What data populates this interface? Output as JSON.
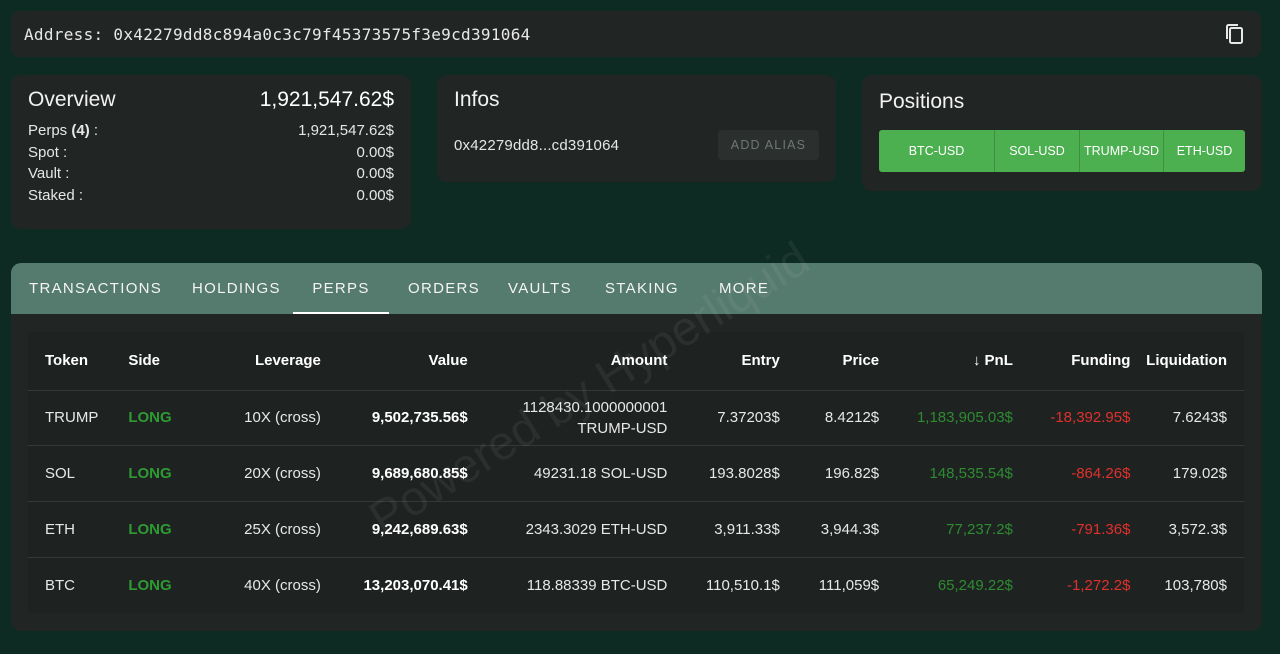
{
  "address_bar": {
    "label": "Address: 0x42279dd8c894a0c3c79f45373575f3e9cd391064",
    "copy_icon": "copy-icon"
  },
  "overview": {
    "title": "Overview",
    "total": "1,921,547.62$",
    "rows": [
      {
        "label": "Perps",
        "count": "(4)",
        "suffix": " :",
        "value": "1,921,547.62$"
      },
      {
        "label": "Spot :",
        "value": "0.00$"
      },
      {
        "label": "Vault :",
        "value": "0.00$"
      },
      {
        "label": "Staked :",
        "value": "0.00$"
      }
    ]
  },
  "infos": {
    "title": "Infos",
    "short_address": "0x42279dd8...cd391064",
    "add_alias": "ADD ALIAS"
  },
  "positions": {
    "title": "Positions",
    "buttons": [
      "BTC-USD",
      "SOL-USD",
      "TRUMP-USD",
      "ETH-USD"
    ],
    "button_color": "#4caf50"
  },
  "tabs": [
    "TRANSACTIONS",
    "HOLDINGS",
    "PERPS",
    "ORDERS",
    "VAULTS",
    "STAKING",
    "MORE"
  ],
  "active_tab": "PERPS",
  "table": {
    "headers": [
      "Token",
      "Side",
      "Leverage",
      "Value",
      "Amount",
      "Entry",
      "Price",
      "PnL",
      "Funding",
      "Liquidation"
    ],
    "sort_icon": "arrow-down-icon",
    "rows": [
      {
        "token": "TRUMP",
        "side": "LONG",
        "leverage": "10X (cross)",
        "value": "9,502,735.56$",
        "amount_line1": "1128430.1000000001",
        "amount_line2": "TRUMP-USD",
        "entry": "7.37203$",
        "price": "8.4212$",
        "pnl": "1,183,905.03$",
        "funding": "-18,392.95$",
        "liquidation": "7.6243$"
      },
      {
        "token": "SOL",
        "side": "LONG",
        "leverage": "20X (cross)",
        "value": "9,689,680.85$",
        "amount_line1": "49231.18 SOL-USD",
        "amount_line2": "",
        "entry": "193.8028$",
        "price": "196.82$",
        "pnl": "148,535.54$",
        "funding": "-864.26$",
        "liquidation": "179.02$"
      },
      {
        "token": "ETH",
        "side": "LONG",
        "leverage": "25X (cross)",
        "value": "9,242,689.63$",
        "amount_line1": "2343.3029 ETH-USD",
        "amount_line2": "",
        "entry": "3,911.33$",
        "price": "3,944.3$",
        "pnl": "77,237.2$",
        "funding": "-791.36$",
        "liquidation": "3,572.3$"
      },
      {
        "token": "BTC",
        "side": "LONG",
        "leverage": "40X (cross)",
        "value": "13,203,070.41$",
        "amount_line1": "118.88339 BTC-USD",
        "amount_line2": "",
        "entry": "110,510.1$",
        "price": "111,059$",
        "pnl": "65,249.22$",
        "funding": "-1,272.2$",
        "liquidation": "103,780$"
      }
    ]
  },
  "watermark": "Powered by Hyperliquid",
  "colors": {
    "background": "#0d2a23",
    "card": "#212624",
    "tab_bar": "#557a6e",
    "long": "#2e9a33",
    "pnl_positive": "#2e8b32",
    "funding_negative": "#e0302c"
  }
}
